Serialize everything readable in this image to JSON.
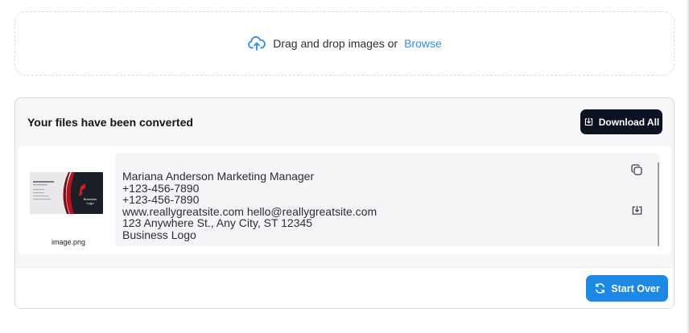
{
  "dropzone": {
    "prompt": "Drag and drop images or",
    "browse_label": "Browse",
    "icon": "cloud-upload-icon",
    "accent": "#2f8fe0"
  },
  "results": {
    "title": "Your files have been converted",
    "download_all_label": "Download All",
    "download_all_color": "#0c1220",
    "files": [
      {
        "filename": "image.png",
        "thumbnail": {
          "heading": "Mariana Anderson",
          "logo_text": "Business Logo"
        },
        "extracted_lines": [
          "Mariana Anderson Marketing Manager",
          "+123-456-7890",
          "+123-456-7890",
          "www.reallygreatsite.com hello@reallygreatsite.com",
          "123 Anywhere St., Any City, ST 12345",
          "Business Logo"
        ],
        "copy_icon": "copy-icon",
        "download_icon": "download-icon"
      }
    ]
  },
  "footer": {
    "start_over_label": "Start Over",
    "start_over_color": "#1e88e5"
  }
}
